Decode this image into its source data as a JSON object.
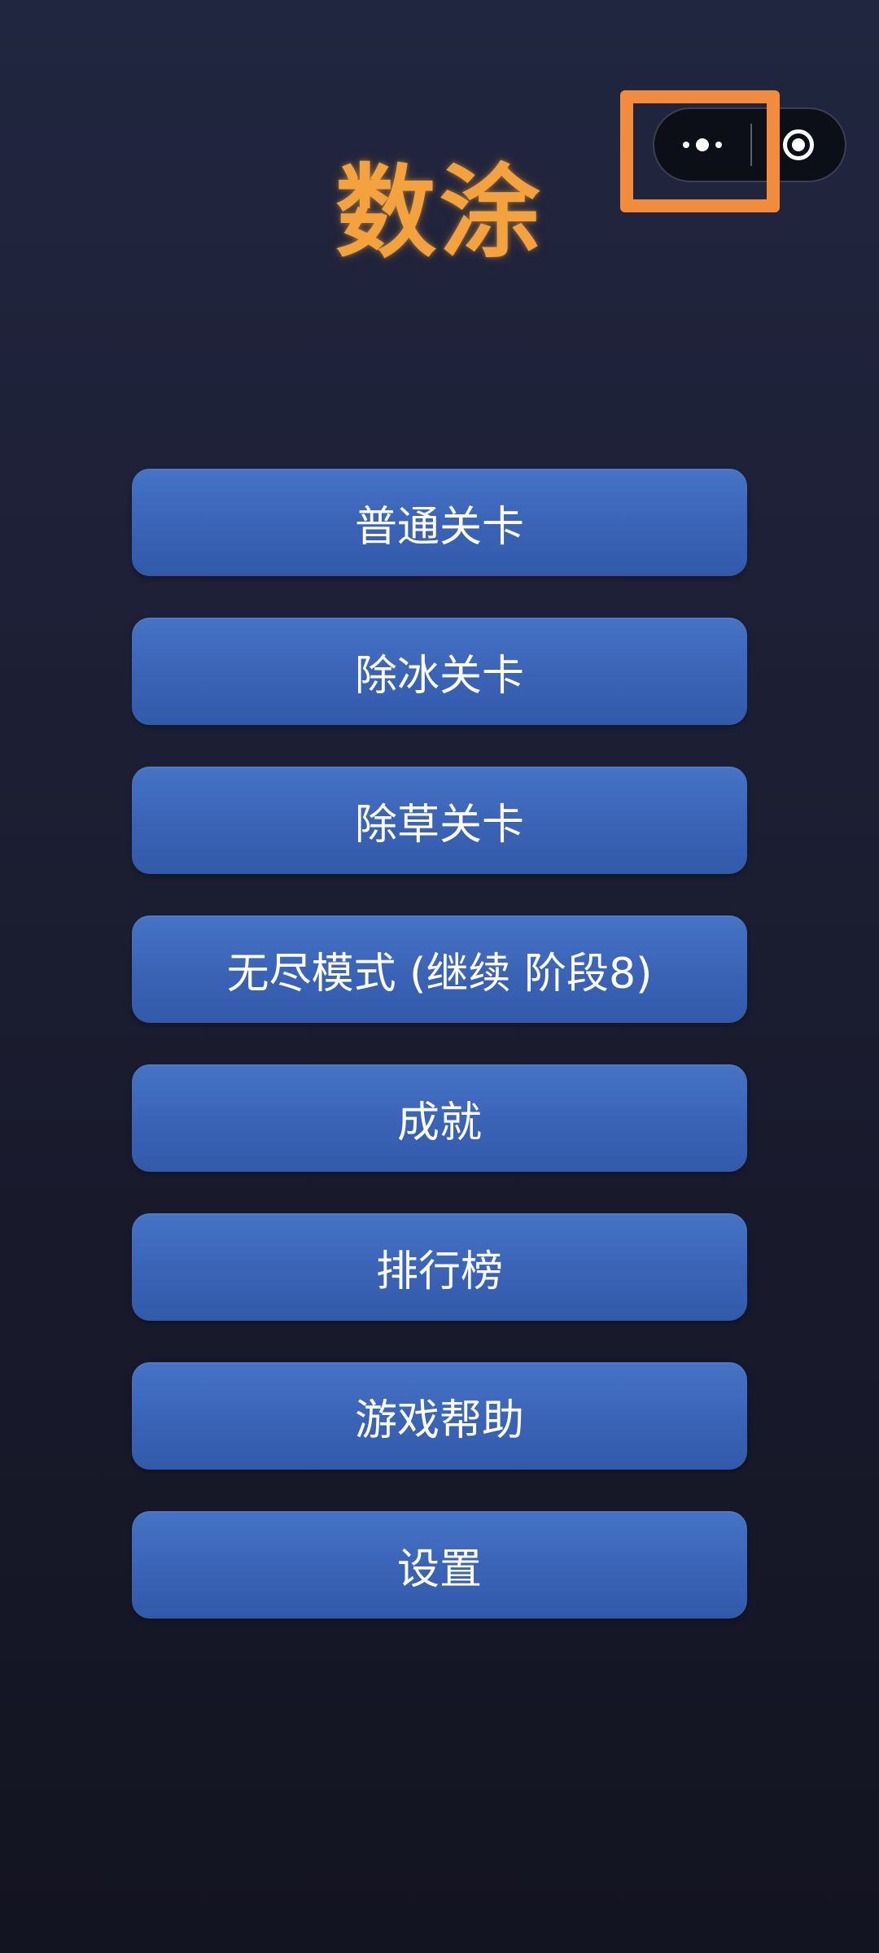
{
  "title": "数涂",
  "capsule": {
    "more_icon": "more-dots-icon",
    "close_icon": "close-target-icon"
  },
  "highlight": {
    "color": "#f28b3c"
  },
  "menu": {
    "items": [
      {
        "label": "普通关卡"
      },
      {
        "label": "除冰关卡"
      },
      {
        "label": "除草关卡"
      },
      {
        "label": "无尽模式 (继续 阶段8)"
      },
      {
        "label": "成就"
      },
      {
        "label": "排行榜"
      },
      {
        "label": "游戏帮助"
      },
      {
        "label": "设置"
      }
    ]
  },
  "colors": {
    "title": "#f3a23e",
    "button": "#3d67b9",
    "background": "#1b1d31"
  }
}
